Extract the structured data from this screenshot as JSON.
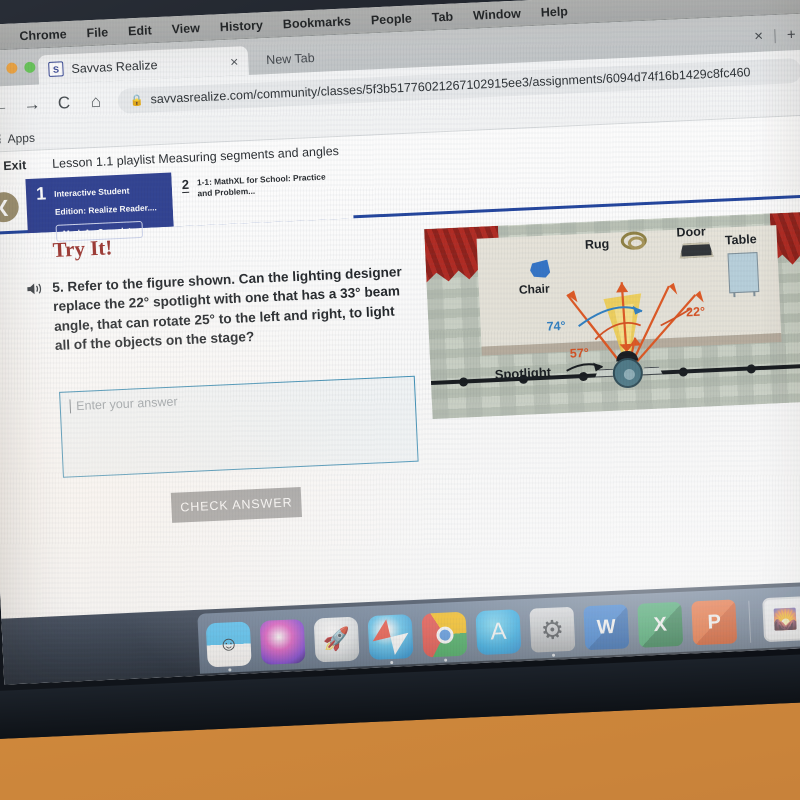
{
  "os": {
    "menubar": {
      "apple_glyph": "",
      "items": [
        "Chrome",
        "File",
        "Edit",
        "View",
        "History",
        "Bookmarks",
        "People",
        "Tab",
        "Window",
        "Help"
      ]
    },
    "dock": {
      "apps": [
        {
          "name": "finder",
          "label": "Finder",
          "glyph": "☺",
          "class": "a-finder",
          "running": true
        },
        {
          "name": "siri",
          "label": "Siri",
          "glyph": "",
          "class": "a-siri",
          "running": false
        },
        {
          "name": "launchpad",
          "label": "Launchpad",
          "glyph": "🚀",
          "class": "a-launch",
          "running": false
        },
        {
          "name": "safari",
          "label": "Safari",
          "glyph": "",
          "class": "a-safari",
          "running": true
        },
        {
          "name": "chrome",
          "label": "Google Chrome",
          "glyph": "",
          "class": "a-chrome",
          "running": true
        },
        {
          "name": "app-store",
          "label": "App Store",
          "glyph": "A",
          "class": "a-appstore",
          "running": false
        },
        {
          "name": "system-preferences",
          "label": "System Preferences",
          "glyph": "⚙",
          "class": "a-sysprefs",
          "running": true
        },
        {
          "name": "word",
          "label": "Microsoft Word",
          "glyph": "W",
          "class": "a-word sq",
          "running": false
        },
        {
          "name": "excel",
          "label": "Microsoft Excel",
          "glyph": "X",
          "class": "a-excel sq",
          "running": false
        },
        {
          "name": "powerpoint",
          "label": "Microsoft PowerPoint",
          "glyph": "P",
          "class": "a-ppt sq",
          "running": false
        },
        {
          "name": "photos",
          "label": "Photos",
          "glyph": "🦅",
          "class": "a-photos sq",
          "running": false
        }
      ]
    }
  },
  "browser": {
    "tab": {
      "title": "Savvas Realize",
      "favicon_text": "S",
      "close_glyph": "×"
    },
    "new_tab_label": "New Tab",
    "tabstrip_close_glyph": "×",
    "tabstrip_new_glyph": "+",
    "nav": {
      "back_glyph": "←",
      "forward_glyph": "→",
      "reload_glyph": "C",
      "home_glyph": "⌂"
    },
    "omnibox": {
      "lock_glyph": "🔒",
      "url": "savvasrealize.com/community/classes/5f3b51776021267102915ee3/assignments/6094d74f16b1429c8fc460"
    },
    "bookmarks": {
      "apps_label": "Apps"
    }
  },
  "lesson": {
    "exit_label": "Exit",
    "exit_chevron": "❮",
    "title": "Lesson 1.1 playlist Measuring segments and angles",
    "back_chevron": "❮",
    "playlist": [
      {
        "number": "1",
        "title": "Interactive Student Edition: Realize Reader....",
        "button_label": "Mark As Complete",
        "active": true
      },
      {
        "number": "2",
        "title": "1-1: MathXL for School: Practice and Problem...",
        "active": false
      }
    ]
  },
  "exercise": {
    "heading": "Try It!",
    "speaker_glyph": "🔊",
    "question": "5. Refer to the figure shown. Can the lighting designer replace the 22° spotlight with one that has a 33° beam angle, that can rotate 25° to the left and right, to light all of the objects on the stage?",
    "answer_input": {
      "value": "",
      "placeholder": "Enter your answer"
    },
    "check_button_label": "CHECK ANSWER"
  },
  "figure": {
    "labels": {
      "rug": "Rug",
      "door": "Door",
      "table": "Table",
      "chair": "Chair",
      "spotlight": "Spotlight"
    },
    "angles": [
      {
        "name": "angle-74",
        "text": "74°",
        "color": "#2c7fc4"
      },
      {
        "name": "angle-22",
        "text": "22°",
        "color": "#d94f1e"
      },
      {
        "name": "angle-57",
        "text": "57°",
        "color": "#d94f1e"
      }
    ]
  },
  "colors": {
    "accent_blue": "#1b3f9c",
    "playlist_active": "#2a3c8f",
    "tryit_red": "#9c322c",
    "input_border": "#3a8fb7",
    "check_button": "#9d9d9d",
    "curtain_red": "#b1241c",
    "wall": "#d8913d"
  }
}
